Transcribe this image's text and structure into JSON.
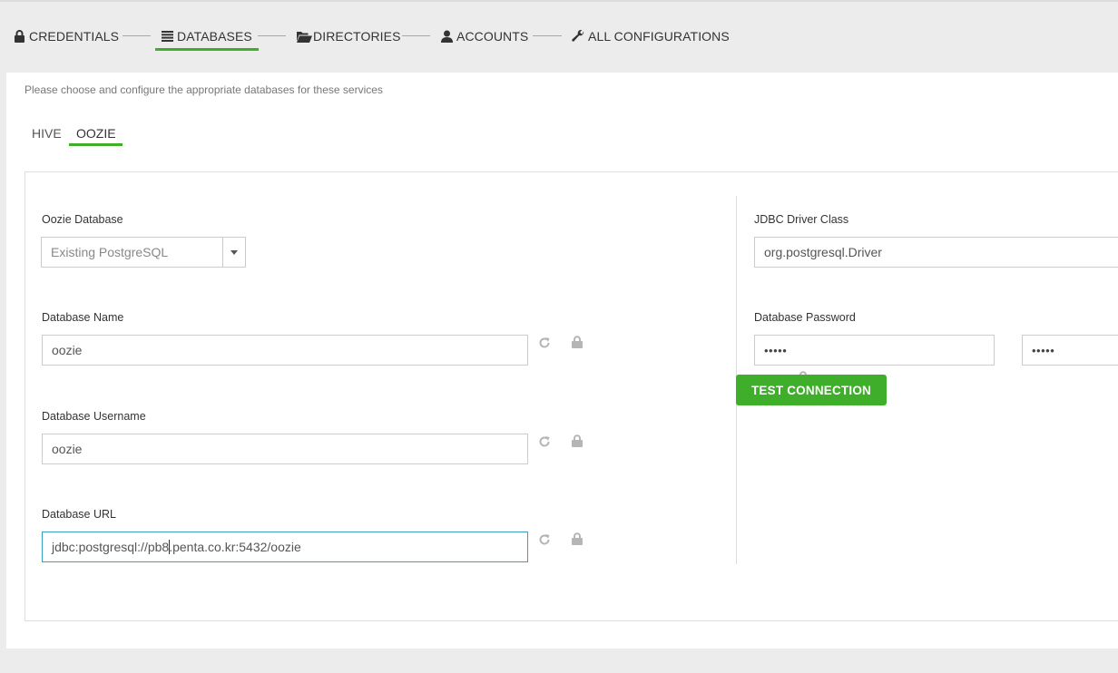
{
  "wizard_steps": [
    {
      "label": "CREDENTIALS",
      "icon": "lock-icon",
      "active": false
    },
    {
      "label": "DATABASES",
      "icon": "list-icon",
      "active": true
    },
    {
      "label": "DIRECTORIES",
      "icon": "folder-open-icon",
      "active": false
    },
    {
      "label": "ACCOUNTS",
      "icon": "user-icon",
      "active": false
    },
    {
      "label": "ALL CONFIGURATIONS",
      "icon": "wrench-icon",
      "active": false
    }
  ],
  "intro_text": "Please choose and configure the appropriate databases for these services",
  "service_tabs": [
    {
      "label": "HIVE",
      "active": false
    },
    {
      "label": "OOZIE",
      "active": true
    }
  ],
  "oozie": {
    "database_label": "Oozie Database",
    "database_value": "Existing PostgreSQL",
    "db_name_label": "Database Name",
    "db_name_value": "oozie",
    "db_username_label": "Database Username",
    "db_username_value": "oozie",
    "db_url_label": "Database URL",
    "db_url_before_cursor": "jdbc:postgresql://pb8",
    "db_url_after_cursor": ".penta.co.kr:5432/oozie",
    "jdbc_driver_label": "JDBC Driver Class",
    "jdbc_driver_value": "org.postgresql.Driver",
    "db_password_label": "Database Password",
    "db_password_value": "•••••",
    "db_password_confirm_value": "•••••",
    "test_connection_label": "TEST CONNECTION"
  },
  "colors": {
    "accent_green": "#3fae2a",
    "focus_border": "#3a9fbf",
    "icon_gray": "#b5b5b5"
  }
}
